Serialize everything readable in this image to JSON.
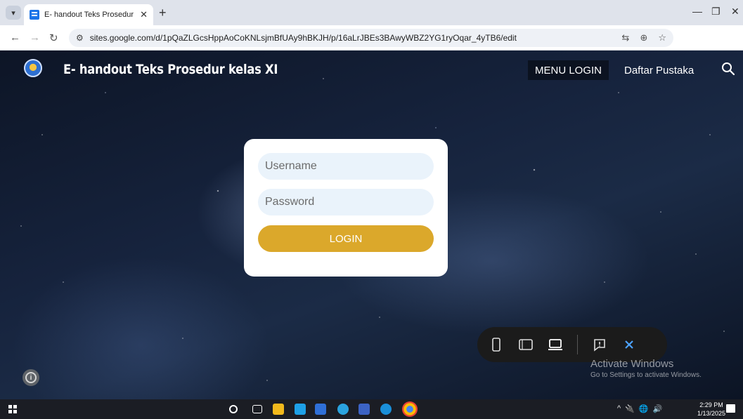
{
  "browser": {
    "tab_title": "E- handout Teks Prosedur kelas XI",
    "url": "sites.google.com/d/1pQaZLGcsHppAoCoKNLsjmBfUAy9hBKJH/p/16aLrJBEs3BAwyWBZ2YG1ryOqar_4yTB6/edit",
    "new_tab_symbol": "+",
    "close_symbol": "✕",
    "icons": [
      "back-icon",
      "forward-icon",
      "reload-icon",
      "site-settings-icon",
      "translate-icon",
      "zoom-icon",
      "star-icon",
      "profile-icon",
      "kebab-menu-icon"
    ]
  },
  "site": {
    "title": "E- handout Teks Prosedur kelas XI",
    "nav": {
      "menu_login": "MENU LOGIN",
      "daftar_pustaka": "Daftar Pustaka"
    }
  },
  "login": {
    "username_placeholder": "Username",
    "password_placeholder": "Password",
    "button_label": "LOGIN",
    "button_color": "#dba82b"
  },
  "watermark": {
    "title": "Activate Windows",
    "subtitle": "Go to Settings to activate Windows."
  },
  "taskbar": {
    "time": "2:29 PM",
    "date": "1/13/2025",
    "tray_symbols": [
      "^",
      "🔌",
      "🌐",
      "🔊"
    ]
  }
}
